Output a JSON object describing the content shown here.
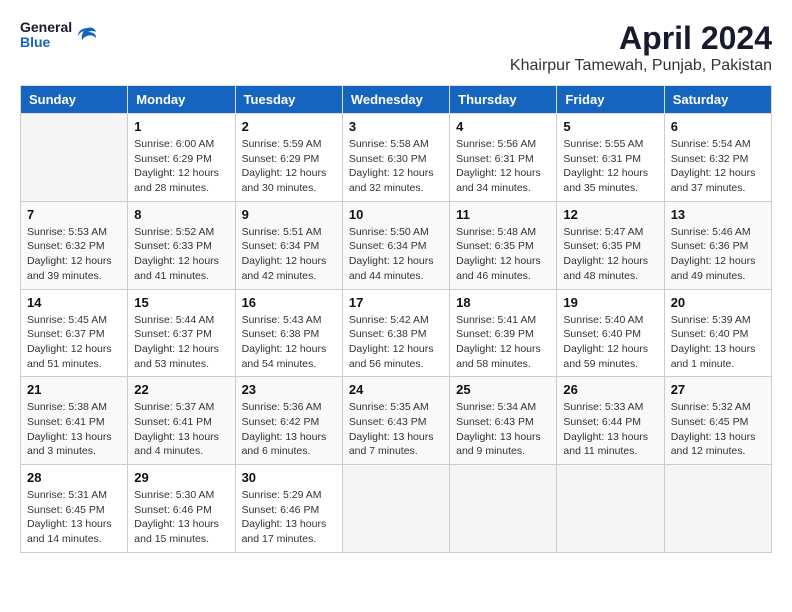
{
  "logo": {
    "line1": "General",
    "line2": "Blue"
  },
  "title": "April 2024",
  "subtitle": "Khairpur Tamewah, Punjab, Pakistan",
  "weekdays": [
    "Sunday",
    "Monday",
    "Tuesday",
    "Wednesday",
    "Thursday",
    "Friday",
    "Saturday"
  ],
  "weeks": [
    [
      {
        "day": "",
        "info": ""
      },
      {
        "day": "1",
        "info": "Sunrise: 6:00 AM\nSunset: 6:29 PM\nDaylight: 12 hours\nand 28 minutes."
      },
      {
        "day": "2",
        "info": "Sunrise: 5:59 AM\nSunset: 6:29 PM\nDaylight: 12 hours\nand 30 minutes."
      },
      {
        "day": "3",
        "info": "Sunrise: 5:58 AM\nSunset: 6:30 PM\nDaylight: 12 hours\nand 32 minutes."
      },
      {
        "day": "4",
        "info": "Sunrise: 5:56 AM\nSunset: 6:31 PM\nDaylight: 12 hours\nand 34 minutes."
      },
      {
        "day": "5",
        "info": "Sunrise: 5:55 AM\nSunset: 6:31 PM\nDaylight: 12 hours\nand 35 minutes."
      },
      {
        "day": "6",
        "info": "Sunrise: 5:54 AM\nSunset: 6:32 PM\nDaylight: 12 hours\nand 37 minutes."
      }
    ],
    [
      {
        "day": "7",
        "info": "Sunrise: 5:53 AM\nSunset: 6:32 PM\nDaylight: 12 hours\nand 39 minutes."
      },
      {
        "day": "8",
        "info": "Sunrise: 5:52 AM\nSunset: 6:33 PM\nDaylight: 12 hours\nand 41 minutes."
      },
      {
        "day": "9",
        "info": "Sunrise: 5:51 AM\nSunset: 6:34 PM\nDaylight: 12 hours\nand 42 minutes."
      },
      {
        "day": "10",
        "info": "Sunrise: 5:50 AM\nSunset: 6:34 PM\nDaylight: 12 hours\nand 44 minutes."
      },
      {
        "day": "11",
        "info": "Sunrise: 5:48 AM\nSunset: 6:35 PM\nDaylight: 12 hours\nand 46 minutes."
      },
      {
        "day": "12",
        "info": "Sunrise: 5:47 AM\nSunset: 6:35 PM\nDaylight: 12 hours\nand 48 minutes."
      },
      {
        "day": "13",
        "info": "Sunrise: 5:46 AM\nSunset: 6:36 PM\nDaylight: 12 hours\nand 49 minutes."
      }
    ],
    [
      {
        "day": "14",
        "info": "Sunrise: 5:45 AM\nSunset: 6:37 PM\nDaylight: 12 hours\nand 51 minutes."
      },
      {
        "day": "15",
        "info": "Sunrise: 5:44 AM\nSunset: 6:37 PM\nDaylight: 12 hours\nand 53 minutes."
      },
      {
        "day": "16",
        "info": "Sunrise: 5:43 AM\nSunset: 6:38 PM\nDaylight: 12 hours\nand 54 minutes."
      },
      {
        "day": "17",
        "info": "Sunrise: 5:42 AM\nSunset: 6:38 PM\nDaylight: 12 hours\nand 56 minutes."
      },
      {
        "day": "18",
        "info": "Sunrise: 5:41 AM\nSunset: 6:39 PM\nDaylight: 12 hours\nand 58 minutes."
      },
      {
        "day": "19",
        "info": "Sunrise: 5:40 AM\nSunset: 6:40 PM\nDaylight: 12 hours\nand 59 minutes."
      },
      {
        "day": "20",
        "info": "Sunrise: 5:39 AM\nSunset: 6:40 PM\nDaylight: 13 hours\nand 1 minute."
      }
    ],
    [
      {
        "day": "21",
        "info": "Sunrise: 5:38 AM\nSunset: 6:41 PM\nDaylight: 13 hours\nand 3 minutes."
      },
      {
        "day": "22",
        "info": "Sunrise: 5:37 AM\nSunset: 6:41 PM\nDaylight: 13 hours\nand 4 minutes."
      },
      {
        "day": "23",
        "info": "Sunrise: 5:36 AM\nSunset: 6:42 PM\nDaylight: 13 hours\nand 6 minutes."
      },
      {
        "day": "24",
        "info": "Sunrise: 5:35 AM\nSunset: 6:43 PM\nDaylight: 13 hours\nand 7 minutes."
      },
      {
        "day": "25",
        "info": "Sunrise: 5:34 AM\nSunset: 6:43 PM\nDaylight: 13 hours\nand 9 minutes."
      },
      {
        "day": "26",
        "info": "Sunrise: 5:33 AM\nSunset: 6:44 PM\nDaylight: 13 hours\nand 11 minutes."
      },
      {
        "day": "27",
        "info": "Sunrise: 5:32 AM\nSunset: 6:45 PM\nDaylight: 13 hours\nand 12 minutes."
      }
    ],
    [
      {
        "day": "28",
        "info": "Sunrise: 5:31 AM\nSunset: 6:45 PM\nDaylight: 13 hours\nand 14 minutes."
      },
      {
        "day": "29",
        "info": "Sunrise: 5:30 AM\nSunset: 6:46 PM\nDaylight: 13 hours\nand 15 minutes."
      },
      {
        "day": "30",
        "info": "Sunrise: 5:29 AM\nSunset: 6:46 PM\nDaylight: 13 hours\nand 17 minutes."
      },
      {
        "day": "",
        "info": ""
      },
      {
        "day": "",
        "info": ""
      },
      {
        "day": "",
        "info": ""
      },
      {
        "day": "",
        "info": ""
      }
    ]
  ]
}
